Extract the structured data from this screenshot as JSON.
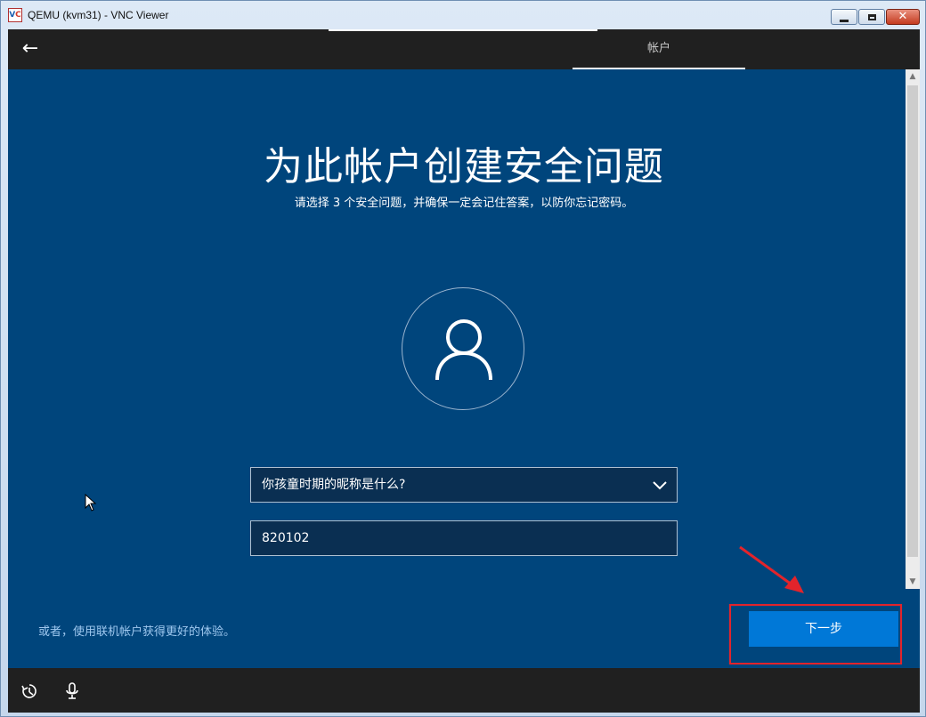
{
  "window": {
    "title": "QEMU (kvm31) - VNC Viewer",
    "logo_v": "V",
    "logo_c": "C",
    "close_glyph": "✕"
  },
  "header": {
    "back_glyph": "←",
    "tab_label": "帐户"
  },
  "main": {
    "title": "为此帐户创建安全问题",
    "subtitle": "请选择 3 个安全问题，并确保一定会记住答案，以防你忘记密码。",
    "question_selected": "你孩童时期的昵称是什么?",
    "answer_value": "820102"
  },
  "footer": {
    "alt_link": "或者，使用联机帐户获得更好的体验。",
    "next_label": "下一步"
  },
  "colors": {
    "background": "#00457c",
    "bar": "#202020",
    "accent": "#0078d7",
    "annotation": "#e3242b"
  },
  "icons": {
    "back": "arrow-left-icon",
    "avatar": "user-icon",
    "dropdown": "chevron-down-icon",
    "ease_of_access": "ease-of-access-icon",
    "microphone": "microphone-icon"
  }
}
